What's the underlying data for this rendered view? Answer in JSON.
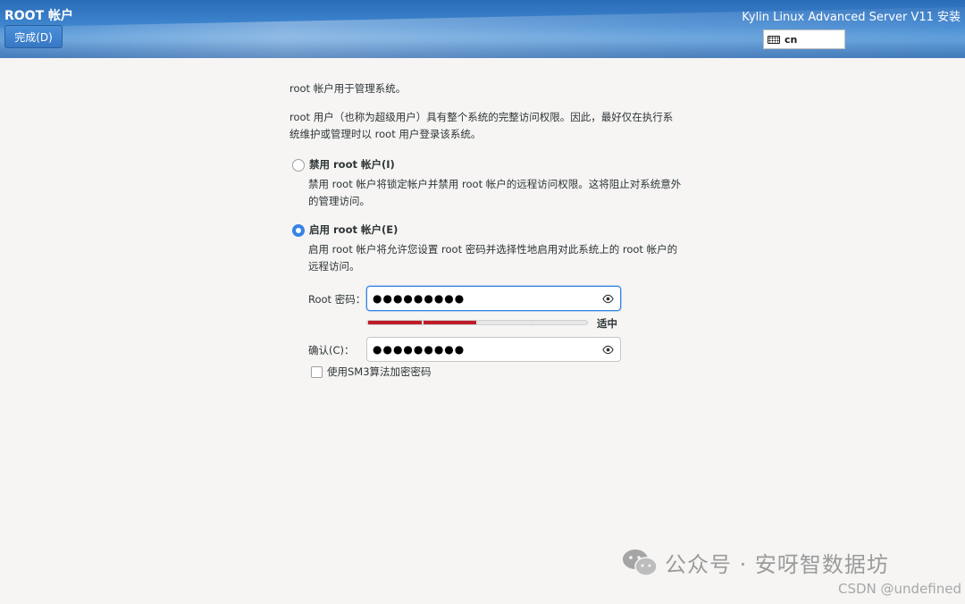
{
  "header": {
    "spoke_title": "ROOT 帐户",
    "done_button": "完成(D)",
    "product_title": "Kylin Linux Advanced Server V11 安装",
    "keyboard_layout": "cn"
  },
  "content": {
    "intro": "root 帐户用于管理系统。",
    "description": "root 用户（也称为超级用户）具有整个系统的完整访问权限。因此，最好仅在执行系统维护或管理时以 root 用户登录该系统。",
    "disable_option": {
      "label": "禁用 root 帐户(I)",
      "description": "禁用 root 帐户将锁定帐户并禁用 root 帐户的远程访问权限。这将阻止对系统意外的管理访问。",
      "selected": false
    },
    "enable_option": {
      "label": "启用 root 帐户(E)",
      "description": "启用 root 帐户将允许您设置 root 密码并选择性地启用对此系统上的 root 帐户的远程访问。",
      "selected": true
    },
    "password": {
      "label": "Root 密码：",
      "value": "●●●●●●●●●",
      "strength_label": "适中",
      "strength_segments_filled": 2,
      "strength_segments_total": 4
    },
    "confirm": {
      "label": "确认(C)：",
      "value": "●●●●●●●●●"
    },
    "sm3_checkbox": {
      "label": "使用SM3算法加密密码",
      "checked": false
    }
  },
  "watermarks": {
    "wechat": "公众号 · 安呀智数据坊",
    "csdn": "CSDN @undefined"
  },
  "colors": {
    "accent": "#3584e4",
    "strength": "#c01c28",
    "header_blue": "#3f86cf"
  }
}
